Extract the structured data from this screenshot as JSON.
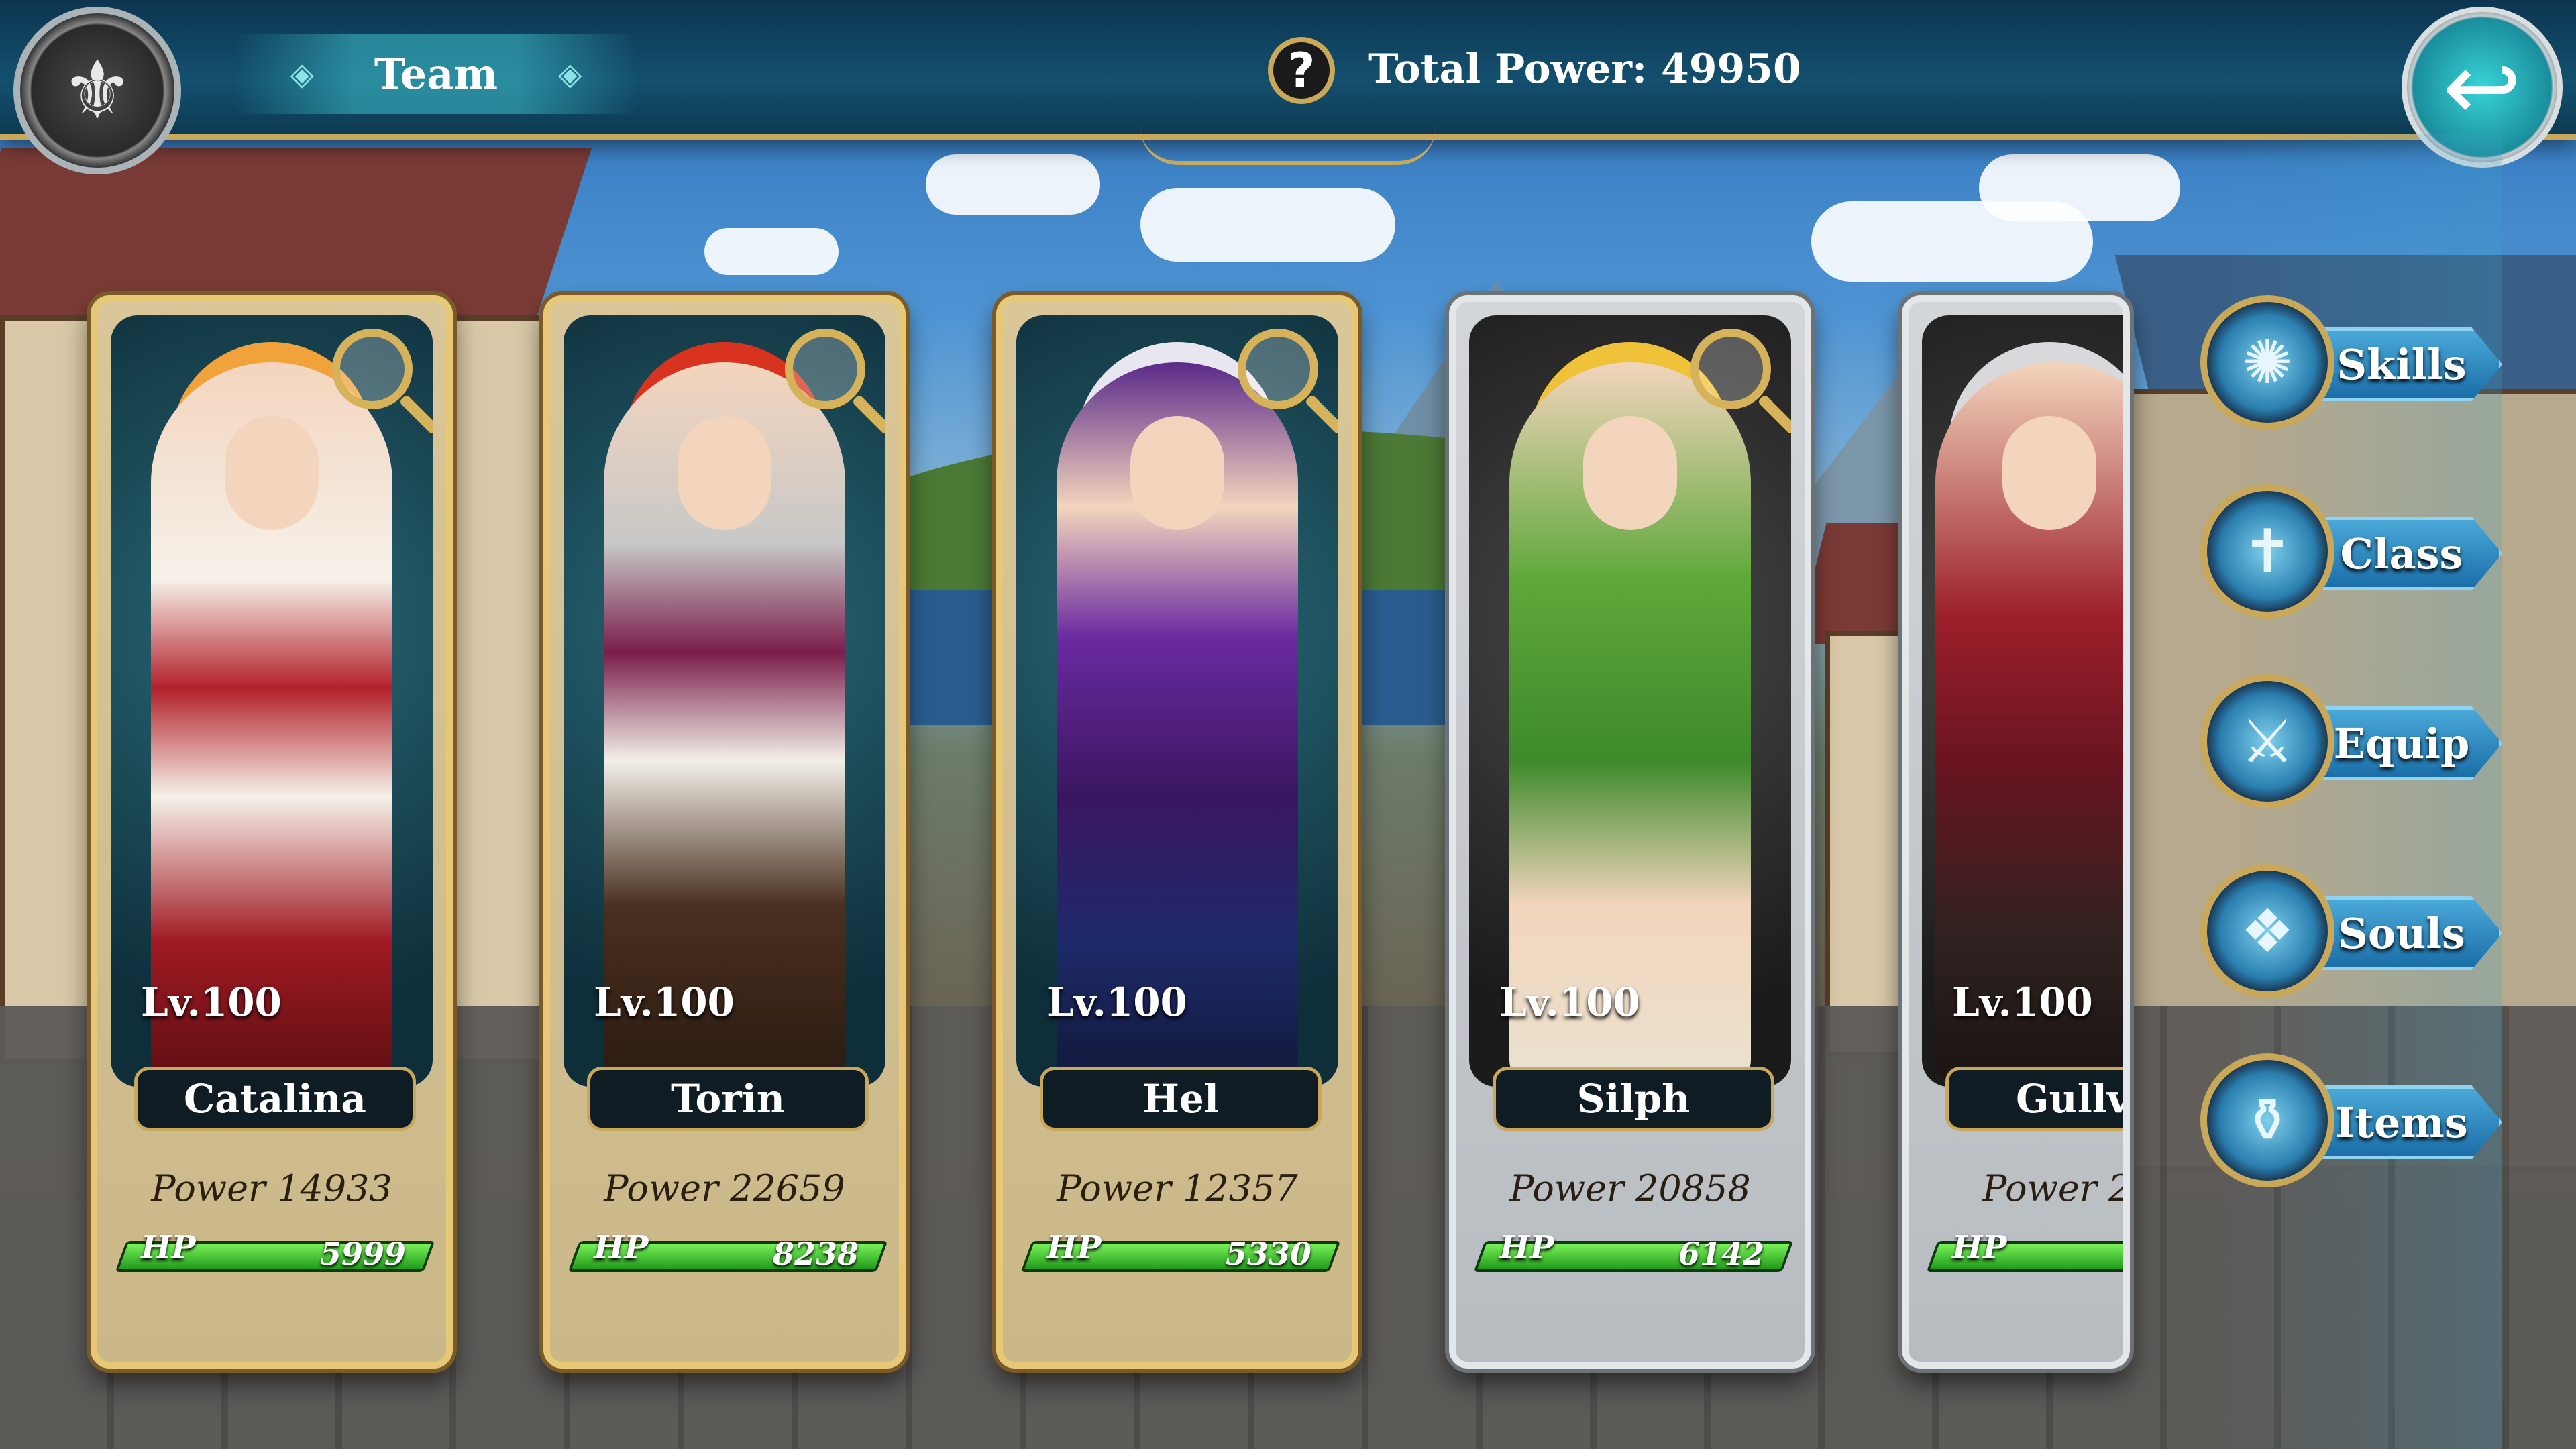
{
  "header": {
    "tab_label": "Team",
    "tab_deco_left": "◈",
    "tab_deco_right": "◈",
    "help_glyph": "?",
    "total_power": "Total Power: 49950",
    "emblem_glyph": "⚜",
    "back_glyph": "↩"
  },
  "heroes": [
    {
      "level": "Lv.100",
      "name": "Catalina",
      "power": "Power 14933",
      "hp_label": "HP",
      "hp": "5999",
      "frame": "gold"
    },
    {
      "level": "Lv.100",
      "name": "Torin",
      "power": "Power 22659",
      "hp_label": "HP",
      "hp": "8238",
      "frame": "gold"
    },
    {
      "level": "Lv.100",
      "name": "Hel",
      "power": "Power 12357",
      "hp_label": "HP",
      "hp": "5330",
      "frame": "gold"
    },
    {
      "level": "Lv.100",
      "name": "Silph",
      "power": "Power 20858",
      "hp_label": "HP",
      "hp": "6142",
      "frame": "silver"
    },
    {
      "level": "Lv.100",
      "name": "Gullve",
      "power": "Power 2",
      "hp_label": "HP",
      "hp": "",
      "frame": "silver"
    }
  ],
  "menu": [
    {
      "label": "Skills",
      "icon": "skills-icon",
      "glyph": "✺"
    },
    {
      "label": "Class",
      "icon": "class-icon",
      "glyph": "✝"
    },
    {
      "label": "Equip",
      "icon": "equip-icon",
      "glyph": "⚔"
    },
    {
      "label": "Souls",
      "icon": "souls-icon",
      "glyph": "❖"
    },
    {
      "label": "Items",
      "icon": "items-icon",
      "glyph": "⚱"
    }
  ],
  "colors": {
    "gold_frame": "#e6c877",
    "silver_frame": "#e4e7ea",
    "hp_bar": "#3fd22a",
    "topbar": "#13506e",
    "menu_ribbon": "#1b6ea8"
  }
}
